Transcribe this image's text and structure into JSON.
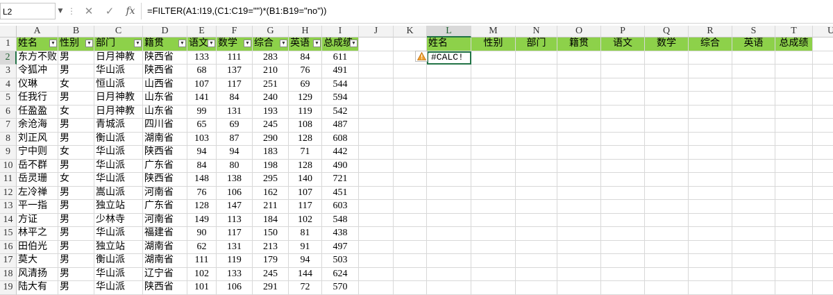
{
  "formula_bar": {
    "name_box": "L2",
    "formula": "=FILTER(A1:I19,(C1:C19=\"\")*(B1:B19=\"no\"))",
    "cancel_glyph": "✕",
    "enter_glyph": "✓",
    "fx_glyph": "fx"
  },
  "columns": [
    "A",
    "B",
    "C",
    "D",
    "E",
    "F",
    "G",
    "H",
    "I",
    "J",
    "K",
    "L",
    "M",
    "N",
    "O",
    "P",
    "Q",
    "R",
    "S",
    "T",
    "U"
  ],
  "rows": [
    "1",
    "2",
    "3",
    "4",
    "5",
    "6",
    "7",
    "8",
    "9",
    "10",
    "11",
    "12",
    "13",
    "14",
    "15",
    "16",
    "17",
    "18",
    "19"
  ],
  "table": {
    "headers": [
      "姓名",
      "性别",
      "部门",
      "籍贯",
      "语文",
      "数学",
      "综合",
      "英语",
      "总成绩"
    ],
    "data": [
      [
        "东方不败",
        "男",
        "日月神教",
        "陕西省",
        "133",
        "111",
        "283",
        "84",
        "611"
      ],
      [
        "令狐冲",
        "男",
        "华山派",
        "陕西省",
        "68",
        "137",
        "210",
        "76",
        "491"
      ],
      [
        "仪琳",
        "女",
        "恒山派",
        "山西省",
        "107",
        "117",
        "251",
        "69",
        "544"
      ],
      [
        "任我行",
        "男",
        "日月神教",
        "山东省",
        "141",
        "84",
        "240",
        "129",
        "594"
      ],
      [
        "任盈盈",
        "女",
        "日月神教",
        "山东省",
        "99",
        "131",
        "193",
        "119",
        "542"
      ],
      [
        "余沧海",
        "男",
        "青城派",
        "四川省",
        "65",
        "69",
        "245",
        "108",
        "487"
      ],
      [
        "刘正风",
        "男",
        "衡山派",
        "湖南省",
        "103",
        "87",
        "290",
        "128",
        "608"
      ],
      [
        "宁中则",
        "女",
        "华山派",
        "陕西省",
        "94",
        "94",
        "183",
        "71",
        "442"
      ],
      [
        "岳不群",
        "男",
        "华山派",
        "广东省",
        "84",
        "80",
        "198",
        "128",
        "490"
      ],
      [
        "岳灵珊",
        "女",
        "华山派",
        "陕西省",
        "148",
        "138",
        "295",
        "140",
        "721"
      ],
      [
        "左冷禅",
        "男",
        "嵩山派",
        "河南省",
        "76",
        "106",
        "162",
        "107",
        "451"
      ],
      [
        "平一指",
        "男",
        "独立站",
        "广东省",
        "128",
        "147",
        "211",
        "117",
        "603"
      ],
      [
        "方证",
        "男",
        "少林寺",
        "河南省",
        "149",
        "113",
        "184",
        "102",
        "548"
      ],
      [
        "林平之",
        "男",
        "华山派",
        "福建省",
        "90",
        "117",
        "150",
        "81",
        "438"
      ],
      [
        "田伯光",
        "男",
        "独立站",
        "湖南省",
        "62",
        "131",
        "213",
        "91",
        "497"
      ],
      [
        "莫大",
        "男",
        "衡山派",
        "湖南省",
        "111",
        "119",
        "179",
        "94",
        "503"
      ],
      [
        "风清扬",
        "男",
        "华山派",
        "辽宁省",
        "102",
        "133",
        "245",
        "144",
        "624"
      ],
      [
        "陆大有",
        "男",
        "华山派",
        "陕西省",
        "101",
        "106",
        "291",
        "72",
        "570"
      ]
    ]
  },
  "result_headers": [
    "姓名",
    "性别",
    "部门",
    "籍贯",
    "语文",
    "数学",
    "综合",
    "英语",
    "总成绩"
  ],
  "result_value": "#CALC!",
  "colors": {
    "header_fill": "#8dd14a",
    "selection": "#217346",
    "warning": "#f0a030"
  }
}
